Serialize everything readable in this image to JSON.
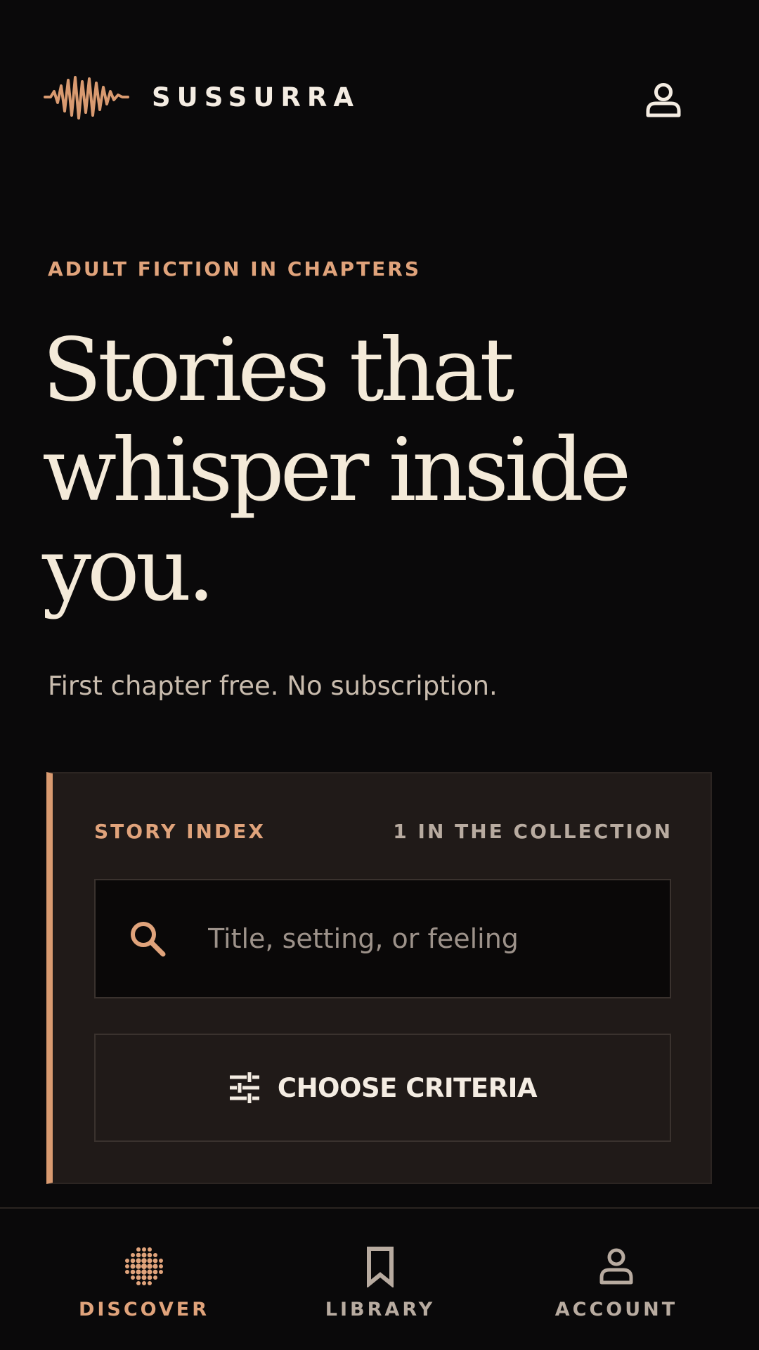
{
  "brand": {
    "name": "SUSSURRA",
    "accent_color": "#d99a70",
    "logo_icon": "waveform-icon"
  },
  "header": {
    "account_icon": "user-icon"
  },
  "hero": {
    "eyebrow": "ADULT FICTION IN CHAPTERS",
    "headline": "Stories that whisper inside you.",
    "subline": "First chapter free. No subscription."
  },
  "story_index": {
    "label": "STORY INDEX",
    "count": "1 IN THE COLLECTION",
    "search": {
      "placeholder": "Title, setting, or feeling",
      "value": "",
      "icon": "search-icon"
    },
    "criteria_button": {
      "label": "CHOOSE CRITERIA",
      "icon": "sliders-icon"
    }
  },
  "bottom_nav": {
    "items": [
      {
        "label": "DISCOVER",
        "icon": "dot-grid-icon",
        "active": true
      },
      {
        "label": "LIBRARY",
        "icon": "bookmark-icon",
        "active": false
      },
      {
        "label": "ACCOUNT",
        "icon": "user-icon",
        "active": false
      }
    ]
  }
}
